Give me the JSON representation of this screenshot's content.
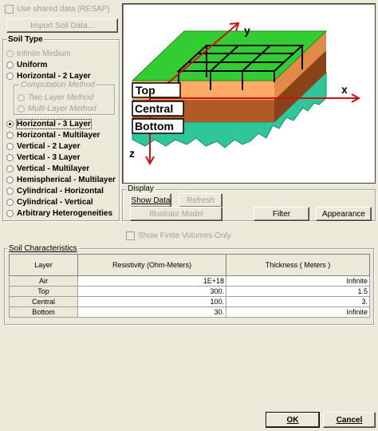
{
  "top": {
    "use_shared_label": "Use shared data (RESAP)",
    "import_button": "Import Soil Data..."
  },
  "soil_type": {
    "title": "Soil Type",
    "options": [
      {
        "label": "Infinite Medium",
        "state": "disabled"
      },
      {
        "label": "Uniform",
        "state": "normal"
      },
      {
        "label": "Horizontal - 2 Layer",
        "state": "normal"
      }
    ],
    "computation_method": {
      "title": "Computation Method",
      "options": [
        "Two Layer Method",
        "Multi-Layer Method"
      ]
    },
    "options_after": [
      {
        "label": "Horizontal - 3 Layer",
        "state": "selected"
      },
      {
        "label": "Horizontal - Multilayer",
        "state": "normal"
      },
      {
        "label": "Vertical - 2 Layer",
        "state": "normal"
      },
      {
        "label": "Vertical - 3 Layer",
        "state": "normal"
      },
      {
        "label": "Vertical - Multilayer",
        "state": "normal"
      },
      {
        "label": "Hemispherical - Multilayer",
        "state": "normal"
      },
      {
        "label": "Cylindrical - Horizontal",
        "state": "normal"
      },
      {
        "label": "Cylindrical - Vertical",
        "state": "normal"
      },
      {
        "label": "Arbitrary Heterogeneities",
        "state": "normal"
      }
    ]
  },
  "diagram": {
    "axis_y": "y",
    "axis_x": "x",
    "axis_z": "z",
    "layer_top": "Top",
    "layer_central": "Central",
    "layer_bottom": "Bottom",
    "colors": {
      "surface": "#33cc33",
      "top": "#ffaa66",
      "central": "#b05a28",
      "bottom": "#2fc79a",
      "axes": "#cc1111"
    }
  },
  "display": {
    "title": "Display",
    "show_data": "Show Data",
    "refresh": "Refresh",
    "illustrate": "Illustrate Model",
    "filter": "Filter",
    "appearance": "Appearance",
    "show_finite": "Show Finite Volumes Only"
  },
  "soil_characteristics": {
    "title": "Soil Characteristics",
    "columns": [
      "Layer",
      "Resistivity (Ohm-Meters)",
      "Thickness ( Meters )"
    ],
    "rows": [
      {
        "layer": "Air",
        "resistivity": "1E+18",
        "thickness": "Infinite"
      },
      {
        "layer": "Top",
        "resistivity": "300.",
        "thickness": "1.5"
      },
      {
        "layer": "Central",
        "resistivity": "100.",
        "thickness": "3."
      },
      {
        "layer": "Bottom",
        "resistivity": "30.",
        "thickness": "Infinite"
      }
    ]
  },
  "footer": {
    "ok": "OK",
    "cancel": "Cancel"
  }
}
